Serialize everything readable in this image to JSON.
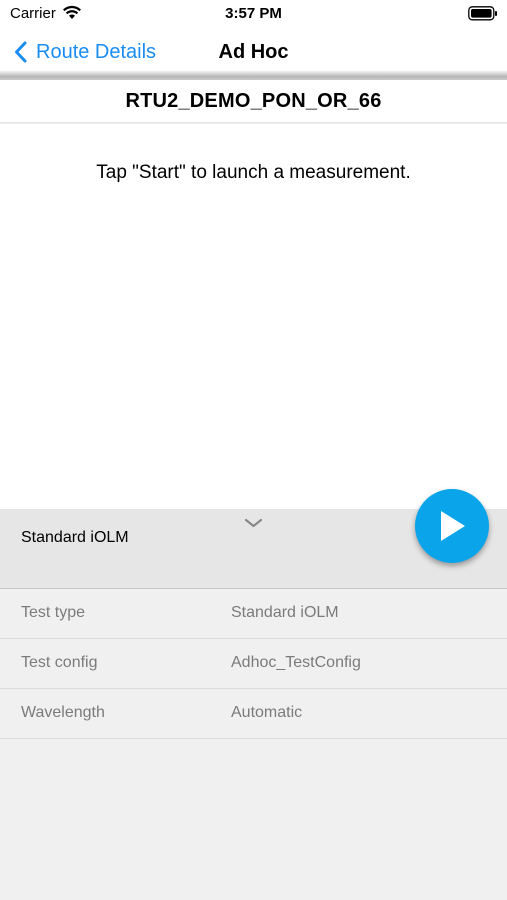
{
  "status_bar": {
    "carrier": "Carrier",
    "time": "3:57 PM",
    "icons": [
      "wifi-icon",
      "battery-icon"
    ]
  },
  "nav": {
    "back_label": "Route Details",
    "title": "Ad Hoc",
    "back_icon": "chevron-left-icon",
    "accent_color": "#1a8df5"
  },
  "route": {
    "name": "RTU2_DEMO_PON_OR_66"
  },
  "main": {
    "hint": "Tap \"Start\" to launch a measurement."
  },
  "panel": {
    "selected_test": "Standard iOLM",
    "expand_icon": "chevron-down-icon",
    "start_icon": "play-icon",
    "start_color": "#0aa4ea"
  },
  "details": [
    {
      "label": "Test type",
      "value": "Standard iOLM"
    },
    {
      "label": "Test config",
      "value": "Adhoc_TestConfig"
    },
    {
      "label": "Wavelength",
      "value": "Automatic"
    }
  ]
}
